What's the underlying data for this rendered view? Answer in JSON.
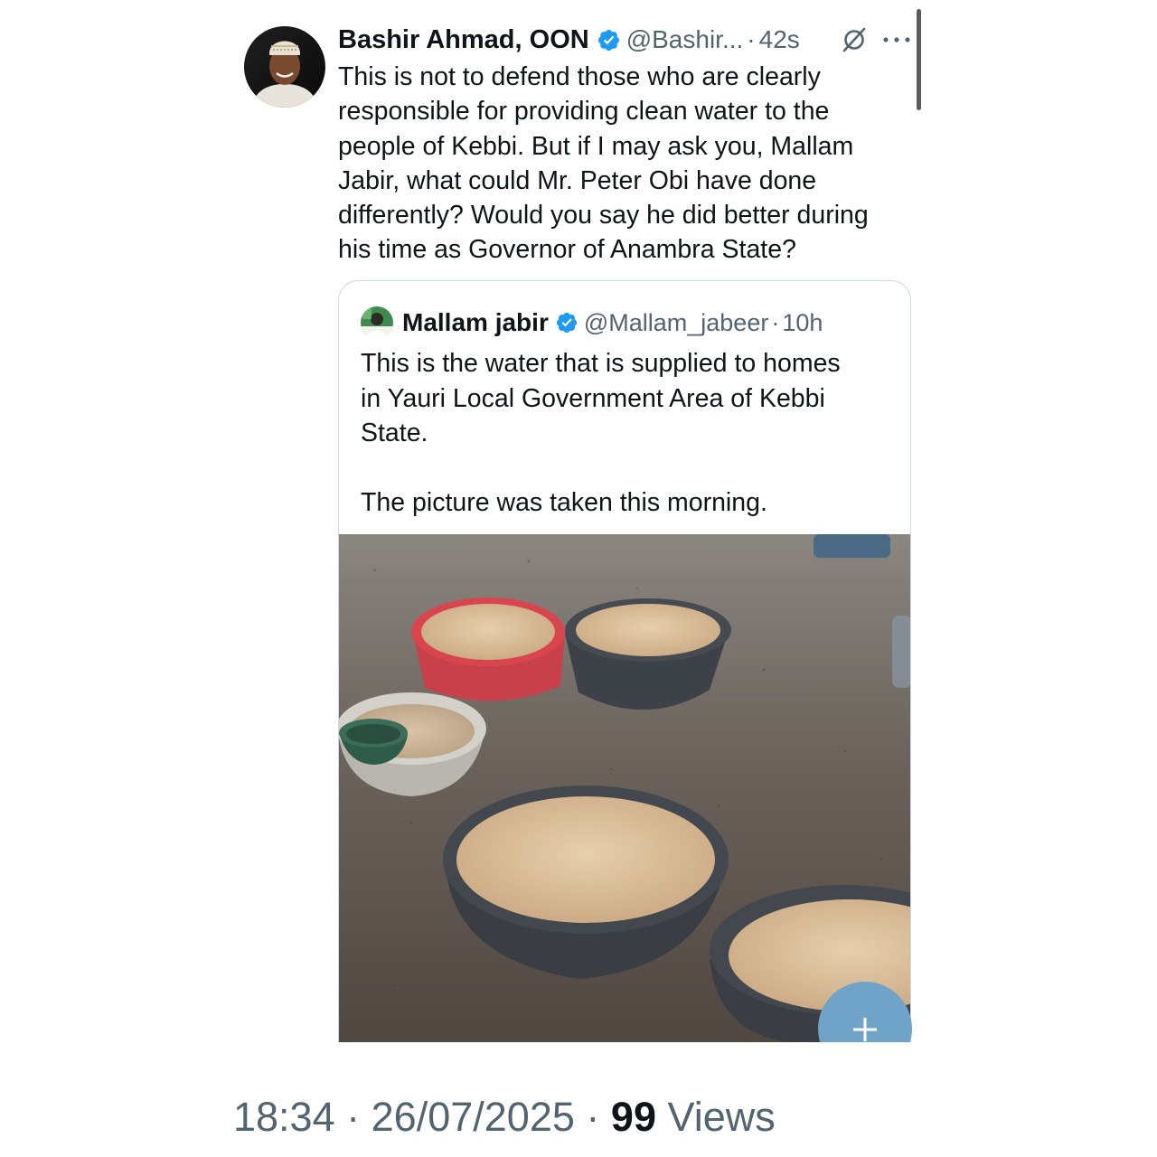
{
  "tweet": {
    "author_name": "Bashir Ahmad, OON",
    "handle": "@Bashir...",
    "separator": "·",
    "time": "42s",
    "text_lines": [
      "This is not to defend those who are clearly",
      "responsible for providing clean water to the",
      "people of Kebbi. But if I may ask you, Mallam",
      "Jabir, what could Mr. Peter Obi have done",
      "differently? Would you say he did better during",
      "his time as Governor of Anambra State?"
    ],
    "verified_color": "#1d9bf0"
  },
  "quoted_tweet": {
    "author_name": "Mallam jabir",
    "handle": "@Mallam_jabeer",
    "separator": "·",
    "time": "10h",
    "text_lines": [
      "This is the water that is supplied to homes",
      "in Yauri Local Government Area of Kebbi",
      "State."
    ],
    "text_line_2": "The picture was taken this morning."
  },
  "meta": {
    "time": "18:34",
    "separator": "·",
    "date": "26/07/2025",
    "views_count": "99",
    "views_label": "Views"
  },
  "icons": {
    "verified": "verified-badge-icon",
    "grok": "grok-icon",
    "more": "more-options-icon",
    "compose": "compose-plus-icon"
  },
  "colors": {
    "accent": "#1d9bf0",
    "text": "#0f1419",
    "secondary": "#536471",
    "fab": "#6fa3c7"
  }
}
